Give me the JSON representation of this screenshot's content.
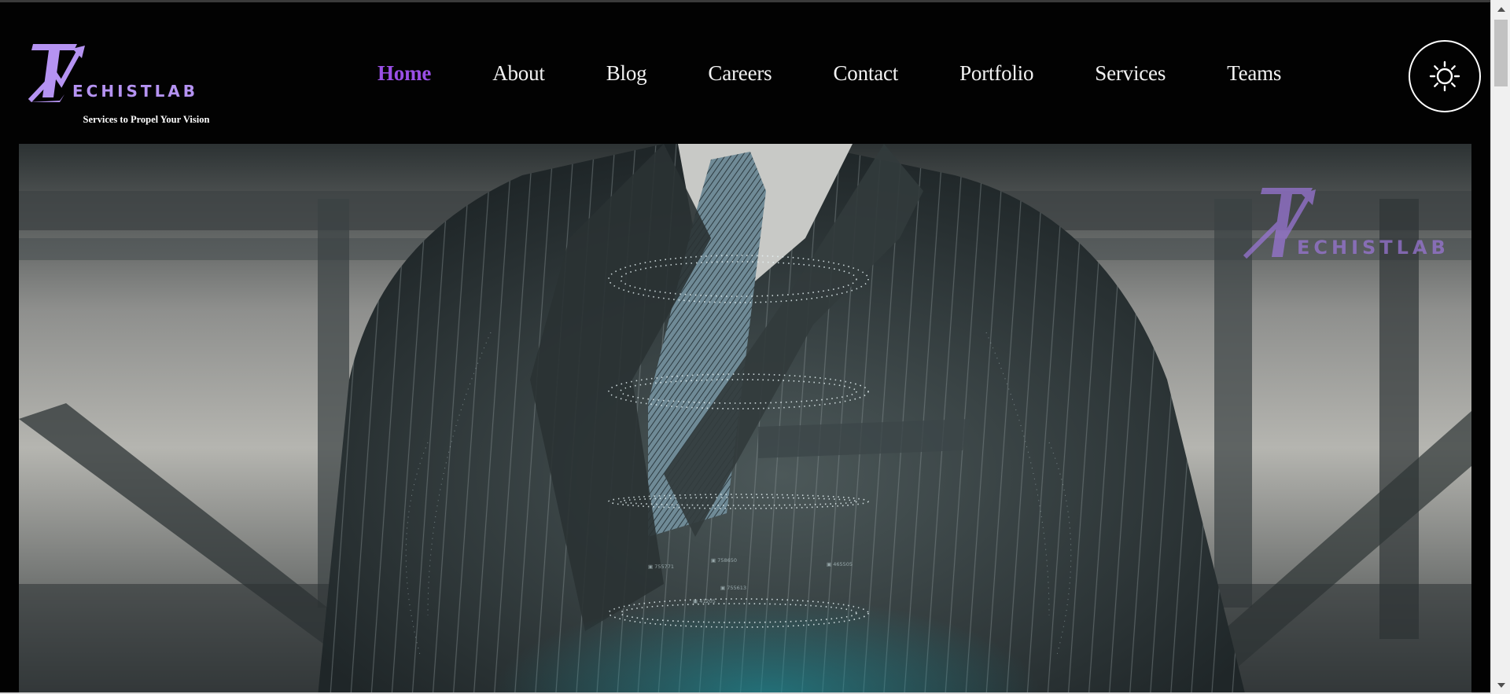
{
  "brand": {
    "logo_text": "ECHISTLAB",
    "logo_letter": "T",
    "tagline": "Services to Propel Your Vision",
    "accent_color": "#b593f2"
  },
  "nav": {
    "items": [
      {
        "label": "Home",
        "active": true
      },
      {
        "label": "About",
        "active": false
      },
      {
        "label": "Blog",
        "active": false
      },
      {
        "label": "Careers",
        "active": false
      },
      {
        "label": "Contact",
        "active": false
      },
      {
        "label": "Portfolio",
        "active": false
      },
      {
        "label": "Services",
        "active": false
      },
      {
        "label": "Teams",
        "active": false
      }
    ],
    "active_color": "#9a4fe6"
  },
  "theme_toggle": {
    "icon": "sun-icon"
  },
  "hero": {
    "watermark_text": "ECHISTLAB",
    "watermark_letter": "T",
    "hologram_labels": [
      "▣ 755771",
      "▣ 758650",
      "▣ 465505",
      "▣ 755613",
      "▣ 41205"
    ]
  }
}
